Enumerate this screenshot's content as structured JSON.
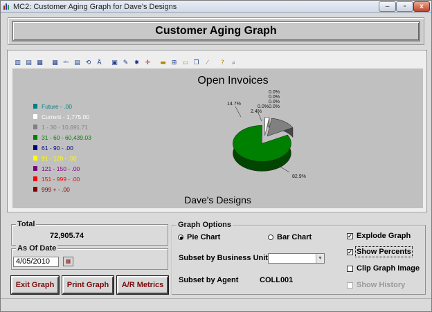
{
  "window": {
    "title": "MC2: Customer Aging Graph for Dave's Designs",
    "min_glyph": "–",
    "max_glyph": "▫",
    "close_glyph": "x"
  },
  "header": {
    "title": "Customer Aging Graph"
  },
  "toolbar": {
    "icons": [
      "bar-chart-icon",
      "3d-chart-icon",
      "stacked-chart-icon",
      "table-icon",
      "abc-icon",
      "grid-icon",
      "rotate-icon",
      "font-icon",
      "palette-icon",
      "color-icon",
      "series-icon",
      "crosshair-icon",
      "legend-icon",
      "gridlines-icon",
      "label-icon",
      "copy-icon",
      "pen-icon",
      "help-icon",
      "zoom-icon"
    ]
  },
  "chart_data": {
    "type": "pie",
    "title": "Open Invoices",
    "footer": "Dave's Designs",
    "exploded": true,
    "show_percents": true,
    "series": [
      {
        "name": "Future - .00",
        "value": 0.0,
        "color": "#008080",
        "percent_label": ""
      },
      {
        "name": "Current - 1,775.00",
        "value": 1775.0,
        "color": "#ffffff",
        "percent_label": "2.4%"
      },
      {
        "name": "1 - 30 - 10,691.71",
        "value": 10691.71,
        "color": "#808080",
        "percent_label": "14.7%"
      },
      {
        "name": "31 - 60 - 60,439.03",
        "value": 60439.03,
        "color": "#008000",
        "percent_label": "82.9%"
      },
      {
        "name": "61 - 90 - .00",
        "value": 0.0,
        "color": "#000080",
        "percent_label": "0.0%"
      },
      {
        "name": "91 - 120 - .00",
        "value": 0.0,
        "color": "#ffff00",
        "percent_label": "0.0%"
      },
      {
        "name": "121 - 150 - .00",
        "value": 0.0,
        "color": "#800080",
        "percent_label": "0.0%"
      },
      {
        "name": "151 - 999 - .00",
        "value": 0.0,
        "color": "#ff0000",
        "percent_label": "0.0%"
      },
      {
        "name": "999 + - .00",
        "value": 0.0,
        "color": "#800000",
        "percent_label": "0.0%"
      }
    ],
    "legend_position": "left"
  },
  "total": {
    "label": "Total",
    "value": "72,905.74"
  },
  "as_of": {
    "label": "As Of Date",
    "date": "4/05/2010"
  },
  "buttons": {
    "exit": "Exit Graph",
    "print": "Print Graph",
    "ar": "A/R Metrics"
  },
  "options": {
    "label": "Graph Options",
    "pie": "Pie Chart",
    "bar": "Bar Chart",
    "selected_type": "pie",
    "subset_business_unit_label": "Subset by Business Unit",
    "subset_business_unit_value": "",
    "subset_agent_label": "Subset by Agent",
    "subset_agent_value": "COLL001",
    "explode": {
      "label": "Explode Graph",
      "checked": true
    },
    "percents": {
      "label": "Show Percents",
      "checked": true
    },
    "clip": {
      "label": "Clip Graph Image",
      "checked": false
    },
    "history": {
      "label": "Show History",
      "checked": false,
      "enabled": false
    }
  }
}
